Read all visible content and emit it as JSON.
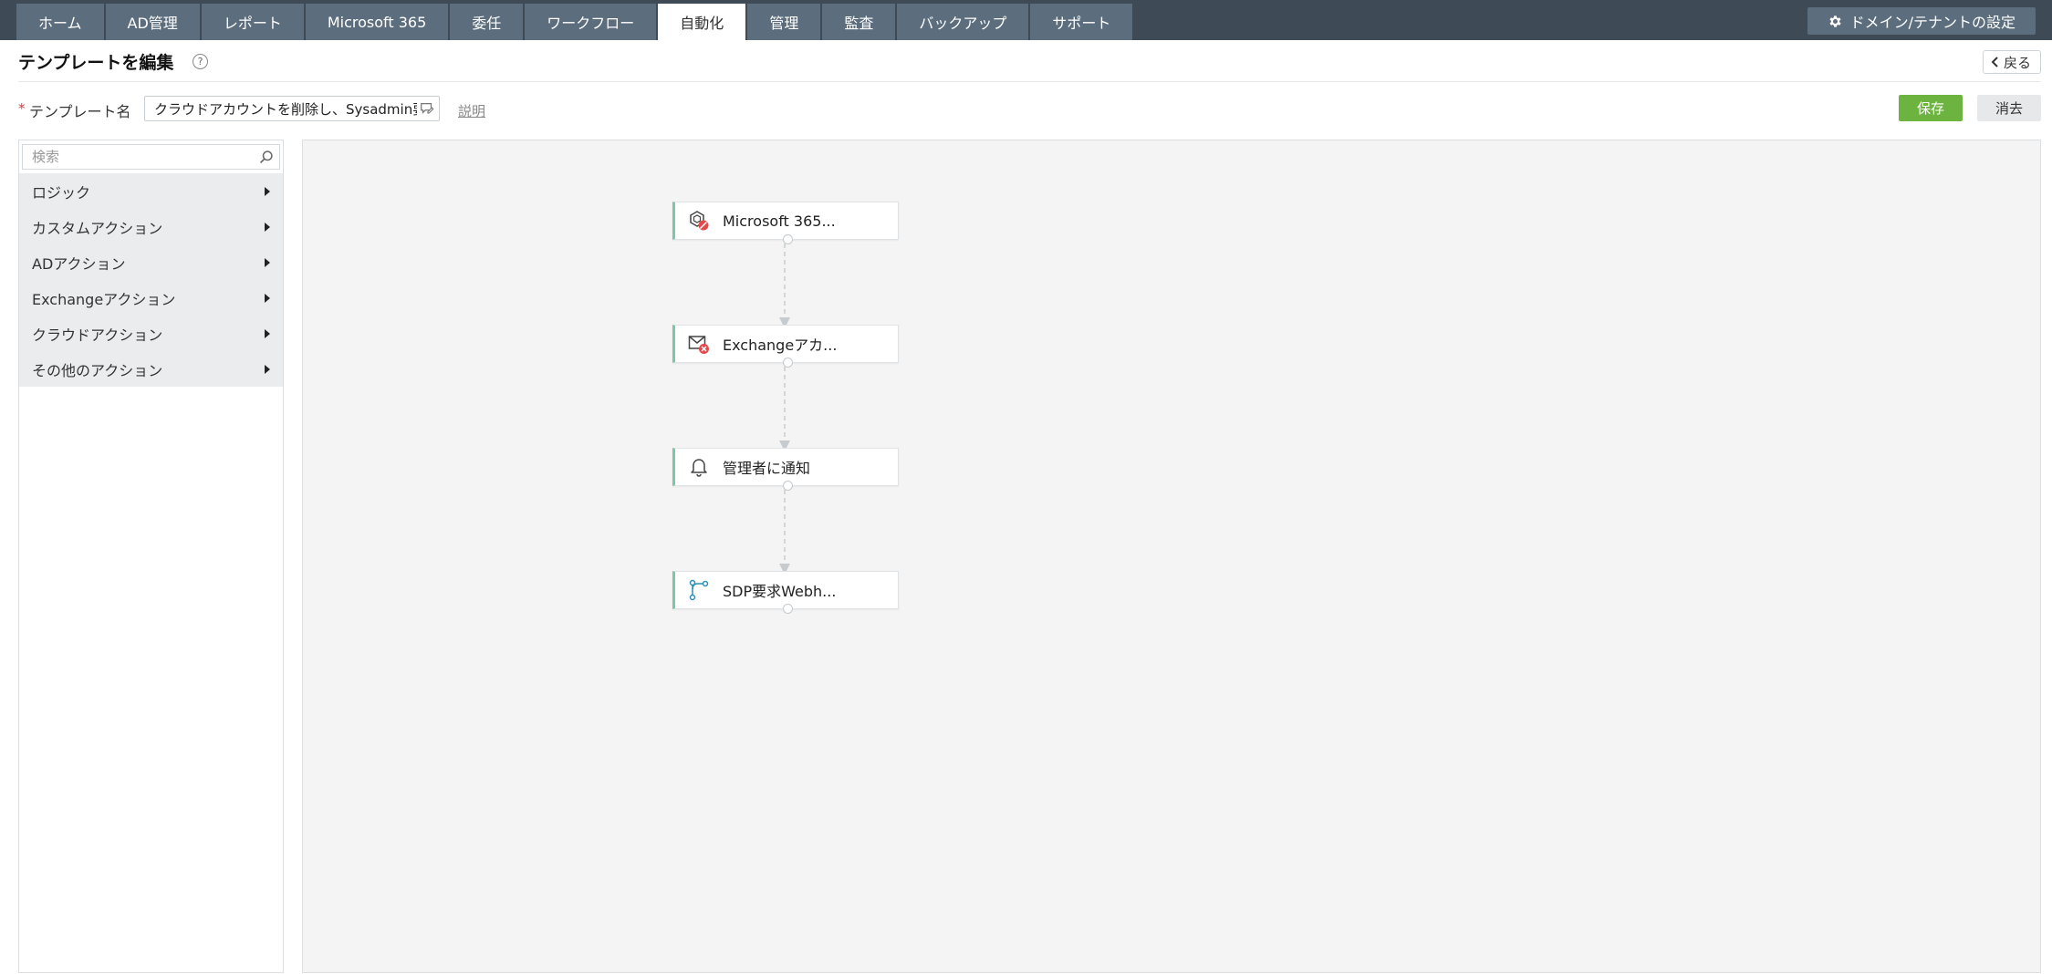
{
  "nav": {
    "tabs": [
      {
        "label": "ホーム"
      },
      {
        "label": "AD管理"
      },
      {
        "label": "レポート"
      },
      {
        "label": "Microsoft 365"
      },
      {
        "label": "委任"
      },
      {
        "label": "ワークフロー"
      },
      {
        "label": "自動化",
        "active": true
      },
      {
        "label": "管理"
      },
      {
        "label": "監査"
      },
      {
        "label": "バックアップ"
      },
      {
        "label": "サポート"
      }
    ],
    "tenant_settings_label": "ドメイン/テナントの設定",
    "tenant_settings_icon": "gear-icon"
  },
  "header": {
    "title": "テンプレートを編集",
    "help_glyph": "?",
    "back_label": "戻る"
  },
  "form": {
    "template_name_label": "テンプレート名",
    "required_marker": "*",
    "template_name_value": "クラウドアカウントを削除し、Sysadmin要求",
    "description_link": "説明",
    "save_label": "保存",
    "clear_label": "消去"
  },
  "sidebar": {
    "search_placeholder": "検索",
    "categories": [
      {
        "label": "ロジック"
      },
      {
        "label": "カスタムアクション"
      },
      {
        "label": "ADアクション"
      },
      {
        "label": "Exchangeアクション"
      },
      {
        "label": "クラウドアクション"
      },
      {
        "label": "その他のアクション"
      }
    ]
  },
  "workflow": {
    "accent_color": "#7cc8a6",
    "nodes": [
      {
        "label": "Microsoft 365...",
        "icon": "m365-delete-icon"
      },
      {
        "label": "Exchangeアカ...",
        "icon": "mail-delete-icon"
      },
      {
        "label": "管理者に通知",
        "icon": "bell-icon"
      },
      {
        "label": "SDP要求Webh...",
        "icon": "webhook-icon"
      }
    ]
  },
  "colors": {
    "topbar": "#3e4a56",
    "tab": "#5c6e7e",
    "save": "#6db33f",
    "danger": "#e04a4a"
  }
}
